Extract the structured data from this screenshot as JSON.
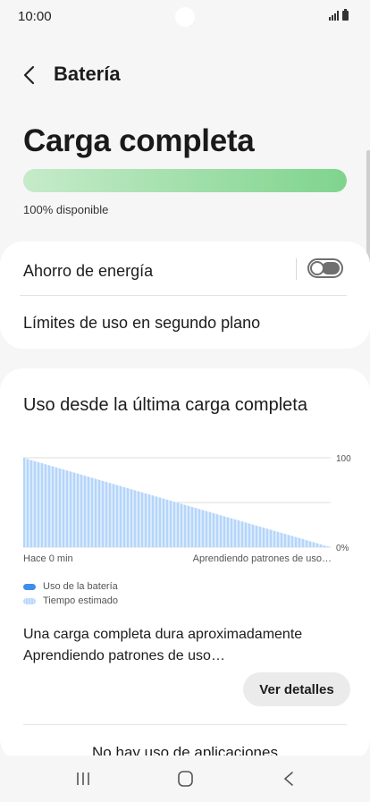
{
  "status": {
    "time": "10:00"
  },
  "appbar": {
    "title": "Batería"
  },
  "battery": {
    "headline": "Carga completa",
    "level_percent": 100,
    "available_text": "100% disponible",
    "fill_color": "#7fd48d"
  },
  "settings": {
    "power_saving_label": "Ahorro de energía",
    "power_saving_on": false,
    "background_limits_label": "Límites de uso en segundo plano"
  },
  "usage": {
    "section_title": "Uso desde la última carga completa",
    "x_start_label": "Hace 0 min",
    "x_end_label": "Aprendiendo patrones de uso…",
    "legend": [
      {
        "label": "Uso de la batería",
        "color": "#3f8ee9"
      },
      {
        "label": "Tiempo estimado",
        "color": "#b8d8fb"
      }
    ],
    "estimate_line1": "Una carga completa dura aproximadamente",
    "estimate_line2": "Aprendiendo patrones de uso…",
    "details_button": "Ver detalles",
    "no_apps_text": "No hay uso de aplicaciones"
  },
  "chart_data": {
    "type": "area",
    "x": [
      0,
      1
    ],
    "series": [
      {
        "name": "Tiempo estimado",
        "values": [
          100,
          0
        ]
      }
    ],
    "y_tick_labels": [
      "100",
      "0%"
    ],
    "ylim": [
      0,
      100
    ],
    "grid": true
  }
}
